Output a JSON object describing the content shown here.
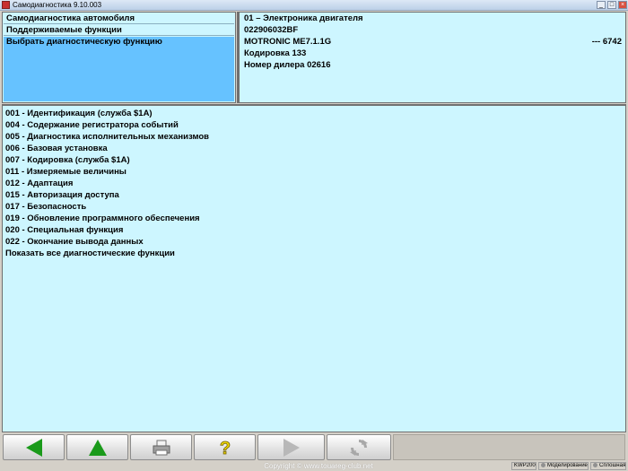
{
  "window": {
    "title": "Самодиагностика 9.10.003",
    "minimize_glyph": "_",
    "maximize_glyph": "□",
    "close_glyph": "×"
  },
  "menu": {
    "items": [
      {
        "label": "Самодиагностика автомобиля"
      },
      {
        "label": "Поддерживаемые функции"
      },
      {
        "label": "Выбрать диагностическую функцию"
      }
    ]
  },
  "info": {
    "lines": [
      "01 – Электроника двигателя",
      "022906032BF",
      "MOTRONIC ME7.1.1G",
      "Кодировка 133",
      "Номер дилера 02616"
    ],
    "right_value": "---  6742"
  },
  "functions": [
    "001 - Идентификация (служба $1A)",
    "004 - Содержание регистратора событий",
    "005 - Диагностика исполнительных механизмов",
    "006 - Базовая установка",
    "007 - Кодировка (служба $1A)",
    "011 - Измеряемые величины",
    "012 - Адаптация",
    "015 - Авторизация доступа",
    "017 - Безопасность",
    "019 - Обновление программного обеспечения",
    "020 - Специальная функция",
    "022 - Окончание вывода данных",
    "Показать все диагностические функции"
  ],
  "toolbar": {
    "buttons": [
      {
        "icon": "arrow-left-icon",
        "color": "#1a9a1a"
      },
      {
        "icon": "arrow-up-icon",
        "color": "#1a9a1a"
      },
      {
        "icon": "printer-icon",
        "color": "#707070"
      },
      {
        "icon": "help-icon",
        "color": "#f0d800"
      },
      {
        "icon": "arrow-right-icon",
        "color": "#b8b8b8"
      },
      {
        "icon": "refresh-icon",
        "color": "#a8a8a8"
      }
    ]
  },
  "footer": {
    "copyright": "Copyright © www.touareg-club.net",
    "status": [
      "KWP2000",
      "Моделирование",
      "Сплошная"
    ]
  },
  "colors": {
    "panel_bg": "#cdf6ff",
    "selected_bg": "#66c2ff"
  }
}
